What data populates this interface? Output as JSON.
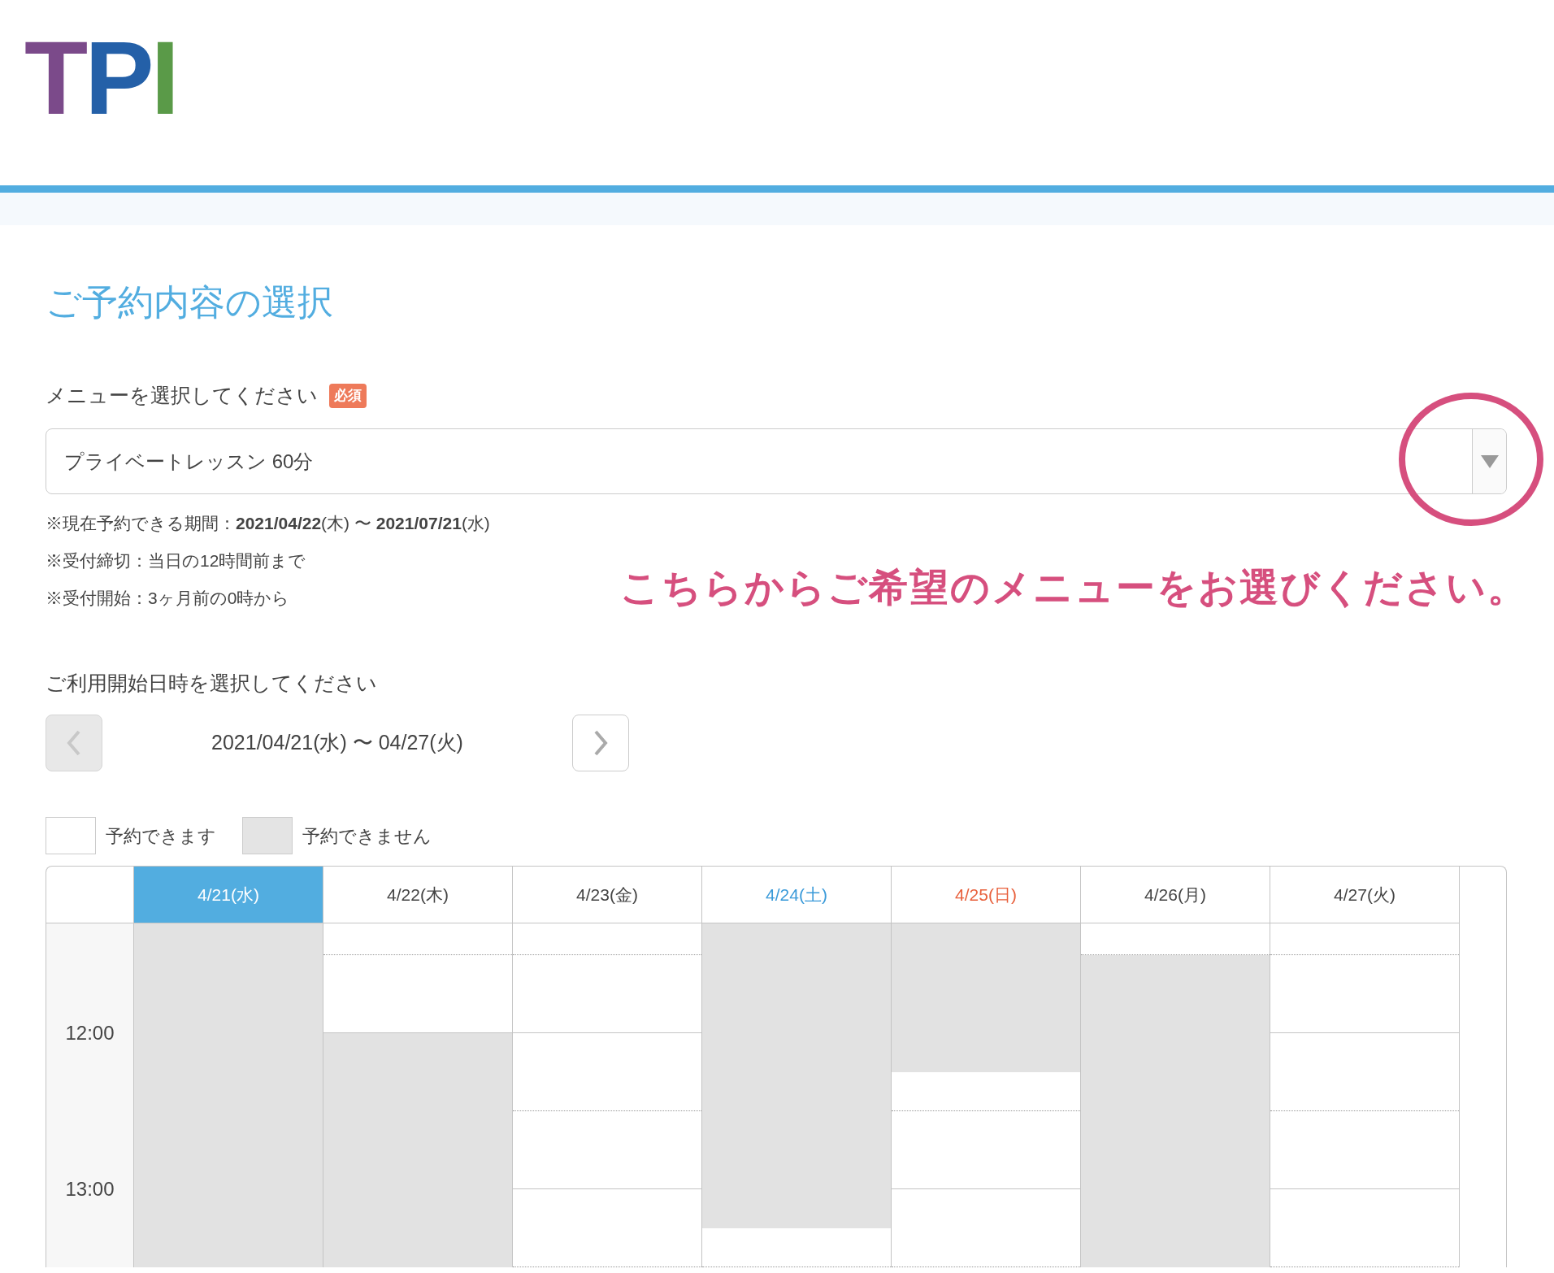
{
  "logo": {
    "letters": [
      {
        "text": "T",
        "color": "#7b4a8a"
      },
      {
        "text": "P",
        "color": "#2460a8"
      },
      {
        "text": "I",
        "color": "#5a9a48"
      }
    ]
  },
  "page_title": "ご予約内容の選択",
  "menu_section": {
    "label": "メニューを選択してください",
    "badge": "必須",
    "select": {
      "value": "プライベートレッスン 60分"
    },
    "notes": [
      "※現在予約できる期間：**2021/04/22**(木) 〜 **2021/07/21**(水)",
      "※受付締切：当日の12時間前まで",
      "※受付開始：3ヶ月前の0時から"
    ]
  },
  "annotation": {
    "text": "こちらからご希望のメニューをお選びください。"
  },
  "date_section": {
    "label": "ご利用開始日時を選択してください",
    "prev": {
      "disabled": true
    },
    "next": {
      "disabled": false
    },
    "range": "2021/04/21(水) 〜 04/27(火)"
  },
  "legend": [
    {
      "label": "予約できます",
      "available": true
    },
    {
      "label": "予約できません",
      "available": false
    }
  ],
  "calendar": {
    "time_labels": [
      "12:00",
      "13:00"
    ],
    "days": [
      {
        "label": "4/21(水)",
        "selected": true,
        "slots": [
          false,
          false,
          false,
          false,
          false,
          false,
          false,
          false,
          false
        ]
      },
      {
        "label": "4/22(木)",
        "selected": false,
        "kind": "weekday",
        "slots": [
          true,
          true,
          true,
          false,
          false,
          false,
          false,
          false,
          false
        ]
      },
      {
        "label": "4/23(金)",
        "selected": false,
        "kind": "weekday",
        "slots": [
          true,
          true,
          true,
          true,
          true,
          true,
          true,
          true,
          true
        ]
      },
      {
        "label": "4/24(土)",
        "selected": false,
        "kind": "saturday",
        "slots": [
          false,
          false,
          false,
          false,
          false,
          false,
          false,
          false,
          true
        ]
      },
      {
        "label": "4/25(日)",
        "selected": false,
        "kind": "sunday",
        "slots": [
          false,
          false,
          false,
          false,
          true,
          true,
          true,
          true,
          true
        ]
      },
      {
        "label": "4/26(月)",
        "selected": false,
        "kind": "weekday",
        "slots": [
          true,
          false,
          false,
          false,
          false,
          false,
          false,
          false,
          false
        ]
      },
      {
        "label": "4/27(火)",
        "selected": false,
        "kind": "weekday",
        "slots": [
          true,
          true,
          true,
          true,
          true,
          true,
          true,
          true,
          true
        ]
      }
    ]
  }
}
